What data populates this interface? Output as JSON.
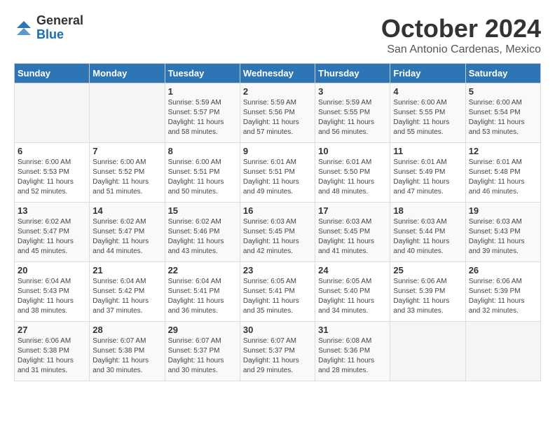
{
  "logo": {
    "general": "General",
    "blue": "Blue"
  },
  "title": "October 2024",
  "location": "San Antonio Cardenas, Mexico",
  "days_header": [
    "Sunday",
    "Monday",
    "Tuesday",
    "Wednesday",
    "Thursday",
    "Friday",
    "Saturday"
  ],
  "weeks": [
    [
      {
        "day": "",
        "info": ""
      },
      {
        "day": "",
        "info": ""
      },
      {
        "day": "1",
        "info": "Sunrise: 5:59 AM\nSunset: 5:57 PM\nDaylight: 11 hours and 58 minutes."
      },
      {
        "day": "2",
        "info": "Sunrise: 5:59 AM\nSunset: 5:56 PM\nDaylight: 11 hours and 57 minutes."
      },
      {
        "day": "3",
        "info": "Sunrise: 5:59 AM\nSunset: 5:55 PM\nDaylight: 11 hours and 56 minutes."
      },
      {
        "day": "4",
        "info": "Sunrise: 6:00 AM\nSunset: 5:55 PM\nDaylight: 11 hours and 55 minutes."
      },
      {
        "day": "5",
        "info": "Sunrise: 6:00 AM\nSunset: 5:54 PM\nDaylight: 11 hours and 53 minutes."
      }
    ],
    [
      {
        "day": "6",
        "info": "Sunrise: 6:00 AM\nSunset: 5:53 PM\nDaylight: 11 hours and 52 minutes."
      },
      {
        "day": "7",
        "info": "Sunrise: 6:00 AM\nSunset: 5:52 PM\nDaylight: 11 hours and 51 minutes."
      },
      {
        "day": "8",
        "info": "Sunrise: 6:00 AM\nSunset: 5:51 PM\nDaylight: 11 hours and 50 minutes."
      },
      {
        "day": "9",
        "info": "Sunrise: 6:01 AM\nSunset: 5:51 PM\nDaylight: 11 hours and 49 minutes."
      },
      {
        "day": "10",
        "info": "Sunrise: 6:01 AM\nSunset: 5:50 PM\nDaylight: 11 hours and 48 minutes."
      },
      {
        "day": "11",
        "info": "Sunrise: 6:01 AM\nSunset: 5:49 PM\nDaylight: 11 hours and 47 minutes."
      },
      {
        "day": "12",
        "info": "Sunrise: 6:01 AM\nSunset: 5:48 PM\nDaylight: 11 hours and 46 minutes."
      }
    ],
    [
      {
        "day": "13",
        "info": "Sunrise: 6:02 AM\nSunset: 5:47 PM\nDaylight: 11 hours and 45 minutes."
      },
      {
        "day": "14",
        "info": "Sunrise: 6:02 AM\nSunset: 5:47 PM\nDaylight: 11 hours and 44 minutes."
      },
      {
        "day": "15",
        "info": "Sunrise: 6:02 AM\nSunset: 5:46 PM\nDaylight: 11 hours and 43 minutes."
      },
      {
        "day": "16",
        "info": "Sunrise: 6:03 AM\nSunset: 5:45 PM\nDaylight: 11 hours and 42 minutes."
      },
      {
        "day": "17",
        "info": "Sunrise: 6:03 AM\nSunset: 5:45 PM\nDaylight: 11 hours and 41 minutes."
      },
      {
        "day": "18",
        "info": "Sunrise: 6:03 AM\nSunset: 5:44 PM\nDaylight: 11 hours and 40 minutes."
      },
      {
        "day": "19",
        "info": "Sunrise: 6:03 AM\nSunset: 5:43 PM\nDaylight: 11 hours and 39 minutes."
      }
    ],
    [
      {
        "day": "20",
        "info": "Sunrise: 6:04 AM\nSunset: 5:43 PM\nDaylight: 11 hours and 38 minutes."
      },
      {
        "day": "21",
        "info": "Sunrise: 6:04 AM\nSunset: 5:42 PM\nDaylight: 11 hours and 37 minutes."
      },
      {
        "day": "22",
        "info": "Sunrise: 6:04 AM\nSunset: 5:41 PM\nDaylight: 11 hours and 36 minutes."
      },
      {
        "day": "23",
        "info": "Sunrise: 6:05 AM\nSunset: 5:41 PM\nDaylight: 11 hours and 35 minutes."
      },
      {
        "day": "24",
        "info": "Sunrise: 6:05 AM\nSunset: 5:40 PM\nDaylight: 11 hours and 34 minutes."
      },
      {
        "day": "25",
        "info": "Sunrise: 6:06 AM\nSunset: 5:39 PM\nDaylight: 11 hours and 33 minutes."
      },
      {
        "day": "26",
        "info": "Sunrise: 6:06 AM\nSunset: 5:39 PM\nDaylight: 11 hours and 32 minutes."
      }
    ],
    [
      {
        "day": "27",
        "info": "Sunrise: 6:06 AM\nSunset: 5:38 PM\nDaylight: 11 hours and 31 minutes."
      },
      {
        "day": "28",
        "info": "Sunrise: 6:07 AM\nSunset: 5:38 PM\nDaylight: 11 hours and 30 minutes."
      },
      {
        "day": "29",
        "info": "Sunrise: 6:07 AM\nSunset: 5:37 PM\nDaylight: 11 hours and 30 minutes."
      },
      {
        "day": "30",
        "info": "Sunrise: 6:07 AM\nSunset: 5:37 PM\nDaylight: 11 hours and 29 minutes."
      },
      {
        "day": "31",
        "info": "Sunrise: 6:08 AM\nSunset: 5:36 PM\nDaylight: 11 hours and 28 minutes."
      },
      {
        "day": "",
        "info": ""
      },
      {
        "day": "",
        "info": ""
      }
    ]
  ]
}
